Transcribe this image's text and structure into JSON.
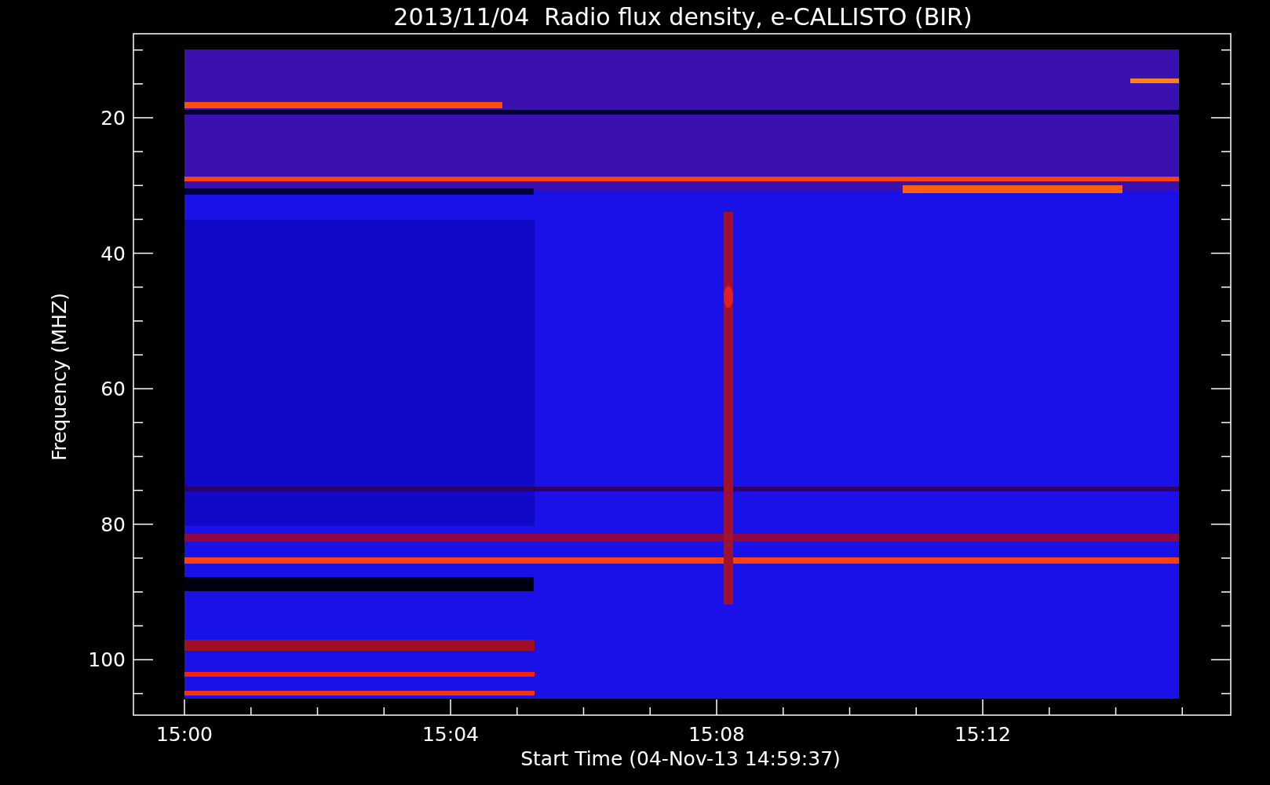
{
  "title": "2013/11/04  Radio flux density, e-CALLISTO (BIR)",
  "y_axis": {
    "label": "Frequency (MHZ)",
    "ticks": [
      "20",
      "40",
      "60",
      "80",
      "100"
    ]
  },
  "x_axis": {
    "label": "Start Time (04-Nov-13 14:59:37)",
    "ticks": [
      "15:00",
      "15:04",
      "15:08",
      "15:12"
    ]
  }
}
